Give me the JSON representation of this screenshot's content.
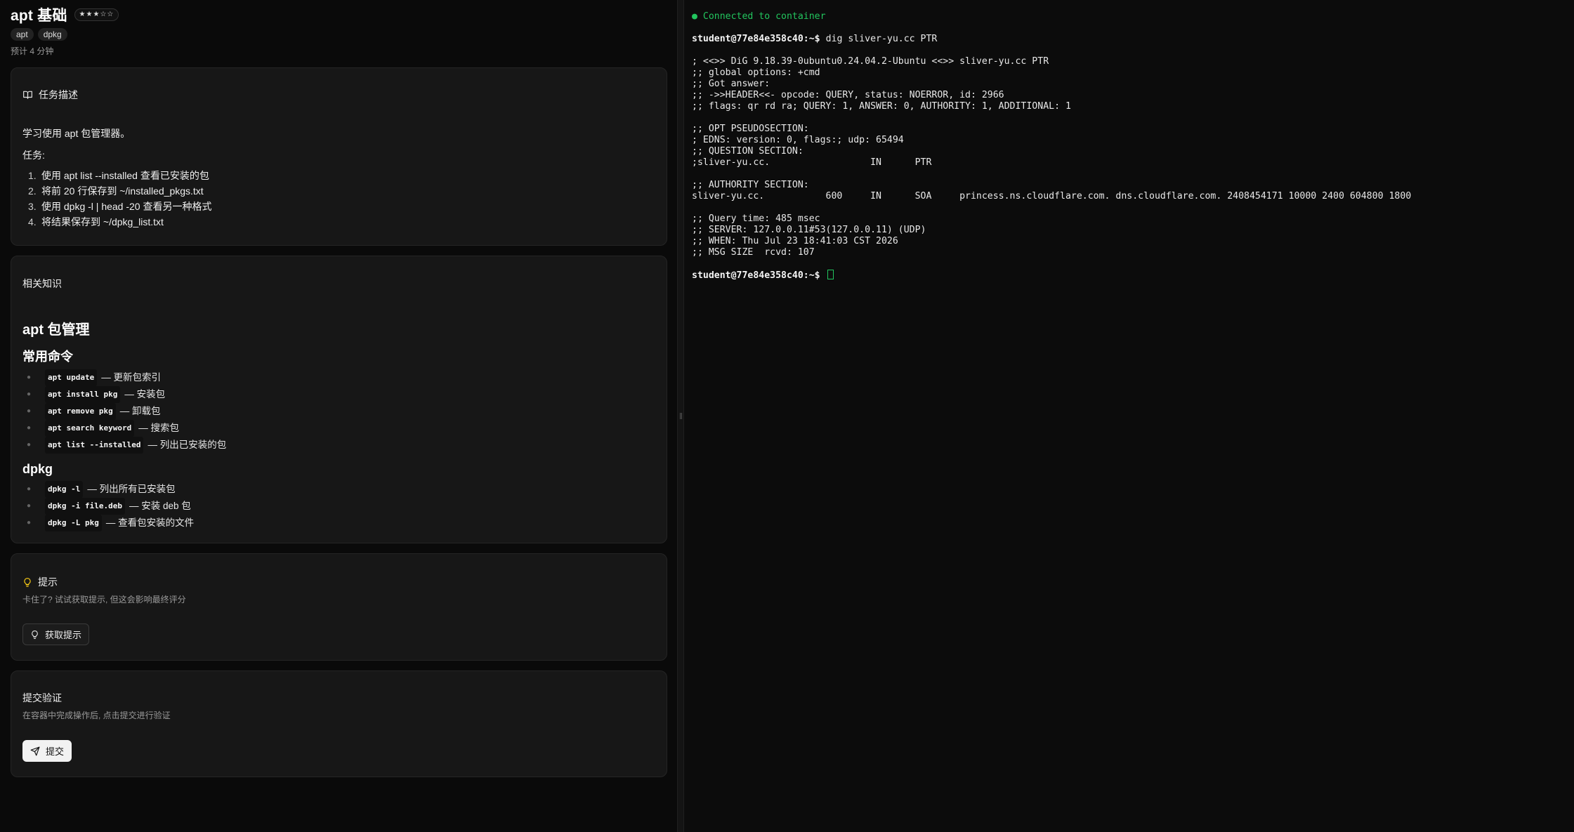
{
  "header": {
    "title": "apt 基础",
    "stars": "★★★☆☆",
    "tags": [
      "apt",
      "dpkg"
    ],
    "estimate": "预计 4 分钟"
  },
  "task": {
    "heading": "任务描述",
    "intro": "学习使用 apt 包管理器。",
    "subheading": "任务:",
    "items": [
      {
        "num": "1.",
        "text": "使用 apt list --installed 查看已安装的包"
      },
      {
        "num": "2.",
        "text": "将前 20 行保存到 ~/installed_pkgs.txt"
      },
      {
        "num": "3.",
        "text": "使用 dpkg -l | head -20 查看另一种格式"
      },
      {
        "num": "4.",
        "text": "将结果保存到 ~/dpkg_list.txt"
      }
    ]
  },
  "knowledge": {
    "heading": "相关知识",
    "h1": "apt 包管理",
    "h2": "常用命令",
    "commands": [
      {
        "code": "apt update",
        "desc": "— 更新包索引"
      },
      {
        "code": "apt install pkg",
        "desc": "— 安装包"
      },
      {
        "code": "apt remove pkg",
        "desc": "— 卸载包"
      },
      {
        "code": "apt search keyword",
        "desc": "— 搜索包"
      },
      {
        "code": "apt list --installed",
        "desc": "— 列出已安装的包"
      }
    ],
    "h2b": "dpkg",
    "dpkg": [
      {
        "code": "dpkg -l",
        "desc": "— 列出所有已安装包"
      },
      {
        "code": "dpkg -i file.deb",
        "desc": "— 安装 deb 包"
      },
      {
        "code": "dpkg -L pkg",
        "desc": "— 查看包安装的文件"
      }
    ]
  },
  "hint": {
    "heading": "提示",
    "sub": "卡住了? 试试获取提示, 但这会影响最终评分",
    "button": "获取提示"
  },
  "submit": {
    "heading": "提交验证",
    "sub": "在容器中完成操作后, 点击提交进行验证",
    "button": "提交"
  },
  "terminal": {
    "status": "● Connected to container",
    "prompt": "student@77e84e358c40:~$",
    "command": "dig sliver-yu.cc PTR",
    "output": [
      "",
      "; <<>> DiG 9.18.39-0ubuntu0.24.04.2-Ubuntu <<>> sliver-yu.cc PTR",
      ";; global options: +cmd",
      ";; Got answer:",
      ";; ->>HEADER<<- opcode: QUERY, status: NOERROR, id: 2966",
      ";; flags: qr rd ra; QUERY: 1, ANSWER: 0, AUTHORITY: 1, ADDITIONAL: 1",
      "",
      ";; OPT PSEUDOSECTION:",
      "; EDNS: version: 0, flags:; udp: 65494",
      ";; QUESTION SECTION:",
      ";sliver-yu.cc.                  IN      PTR",
      "",
      ";; AUTHORITY SECTION:",
      "sliver-yu.cc.           600     IN      SOA     princess.ns.cloudflare.com. dns.cloudflare.com. 2408454171 10000 2400 604800 1800",
      "",
      ";; Query time: 485 msec",
      ";; SERVER: 127.0.0.11#53(127.0.0.11) (UDP)",
      ";; WHEN: Thu Jul 23 18:41:03 CST 2026",
      ";; MSG SIZE  rcvd: 107",
      ""
    ]
  }
}
